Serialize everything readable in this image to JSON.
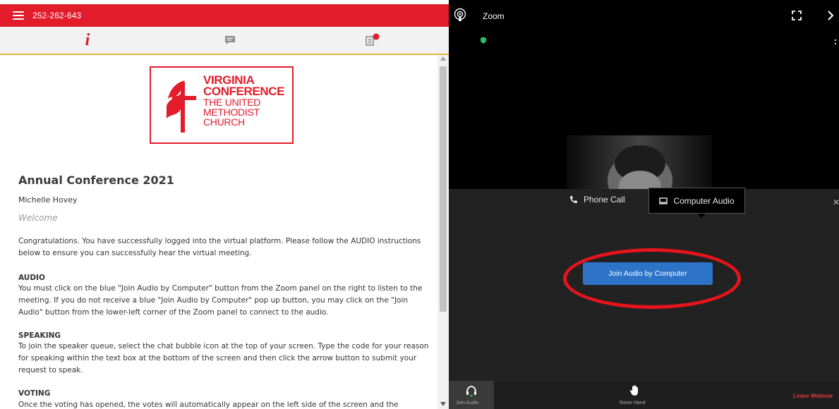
{
  "left": {
    "meeting_id": "252-262-643",
    "tabs": [
      {
        "name": "info",
        "glyph": "i"
      },
      {
        "name": "chat"
      },
      {
        "name": "documents"
      }
    ],
    "logo": {
      "line1": "VIRGINIA",
      "line2": "CONFERENCE",
      "line3": "THE UNITED",
      "line4": "METHODIST",
      "line5": "CHURCH"
    },
    "title": "Annual Conference 2021",
    "speaker": "Michelle Hovey",
    "welcome": "Welcome",
    "intro": "Congratulations. You have successfully logged into the virtual platform. Please follow the AUDIO instructions below to ensure you can successfully hear the virtual meeting.",
    "audio_heading": "AUDIO",
    "audio_text": "You must click on the blue \"Join Audio by Computer\" button from the Zoom panel on the right to listen to the meeting. If you do not receive a blue \"Join Audio by Computer\" pop up button, you may click on the \"Join Audio\" button from the lower-left corner of the Zoom panel to connect to the audio.",
    "speaking_heading": "SPEAKING",
    "speaking_text": "To join the speaker queue, select the chat bubble icon at the top of your screen. Type the code for your reason for speaking within the text box at the bottom of the screen and then click the arrow button to submit your request to speak.",
    "voting_heading": "VOTING",
    "voting_text": "Once the voting has opened, the votes will automatically appear on the left side of the screen and the"
  },
  "zoom": {
    "title": "Zoom",
    "phone_call_label": "Phone Call",
    "computer_audio_label": "Computer Audio",
    "join_button_label": "Join Audio by Computer",
    "toolbar": {
      "join_audio_label": "Join Audio",
      "raise_hand_label": "Raise Hand",
      "leave_label": "Leave Webinar"
    }
  },
  "colors": {
    "brand_red": "#e21c2a",
    "join_blue": "#2d74c9",
    "leave_red": "#e43a3a"
  }
}
